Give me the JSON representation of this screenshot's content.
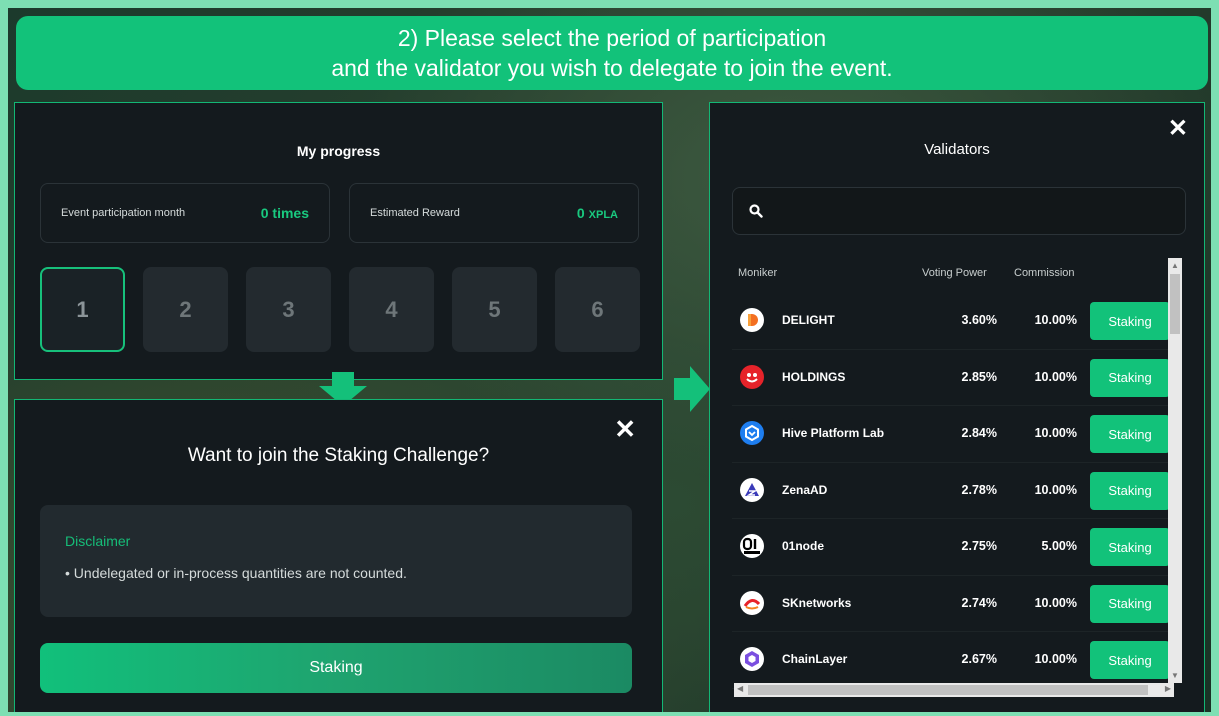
{
  "banner": {
    "line1": "2) Please select the period of participation",
    "line2": "and the validator you wish to delegate to join the event."
  },
  "progress": {
    "title": "My progress",
    "participation_label": "Event participation month",
    "participation_value": "0 times",
    "reward_label": "Estimated Reward",
    "reward_value": "0",
    "reward_unit": "XPLA",
    "months": [
      "1",
      "2",
      "3",
      "4",
      "5",
      "6"
    ],
    "selected_month": "1"
  },
  "join": {
    "title": "Want to join the Staking Challenge?",
    "disclaimer_title": "Disclaimer",
    "disclaimer_text": "• Undelegated or in-process quantities are not counted.",
    "button": "Staking"
  },
  "validators": {
    "title": "Validators",
    "search_placeholder": "",
    "columns": [
      "Moniker",
      "Voting Power",
      "Commission"
    ],
    "rows": [
      {
        "moniker": "DELIGHT",
        "voting_power": "3.60%",
        "commission": "10.00%",
        "button": "Staking",
        "icon": "delight-logo"
      },
      {
        "moniker": "HOLDINGS",
        "voting_power": "2.85%",
        "commission": "10.00%",
        "button": "Staking",
        "icon": "holdings-logo"
      },
      {
        "moniker": "Hive Platform Lab",
        "voting_power": "2.84%",
        "commission": "10.00%",
        "button": "Staking",
        "icon": "hive-logo"
      },
      {
        "moniker": "ZenaAD",
        "voting_power": "2.78%",
        "commission": "10.00%",
        "button": "Staking",
        "icon": "zenaad-logo"
      },
      {
        "moniker": "01node",
        "voting_power": "2.75%",
        "commission": "5.00%",
        "button": "Staking",
        "icon": "01node-logo"
      },
      {
        "moniker": "SKnetworks",
        "voting_power": "2.74%",
        "commission": "10.00%",
        "button": "Staking",
        "icon": "sknetworks-logo"
      },
      {
        "moniker": "ChainLayer",
        "voting_power": "2.67%",
        "commission": "10.00%",
        "button": "Staking",
        "icon": "chainlayer-logo"
      }
    ]
  },
  "colors": {
    "accent": "#12c27a",
    "panel": "#141a1e",
    "frame": "#7ddfb3"
  }
}
